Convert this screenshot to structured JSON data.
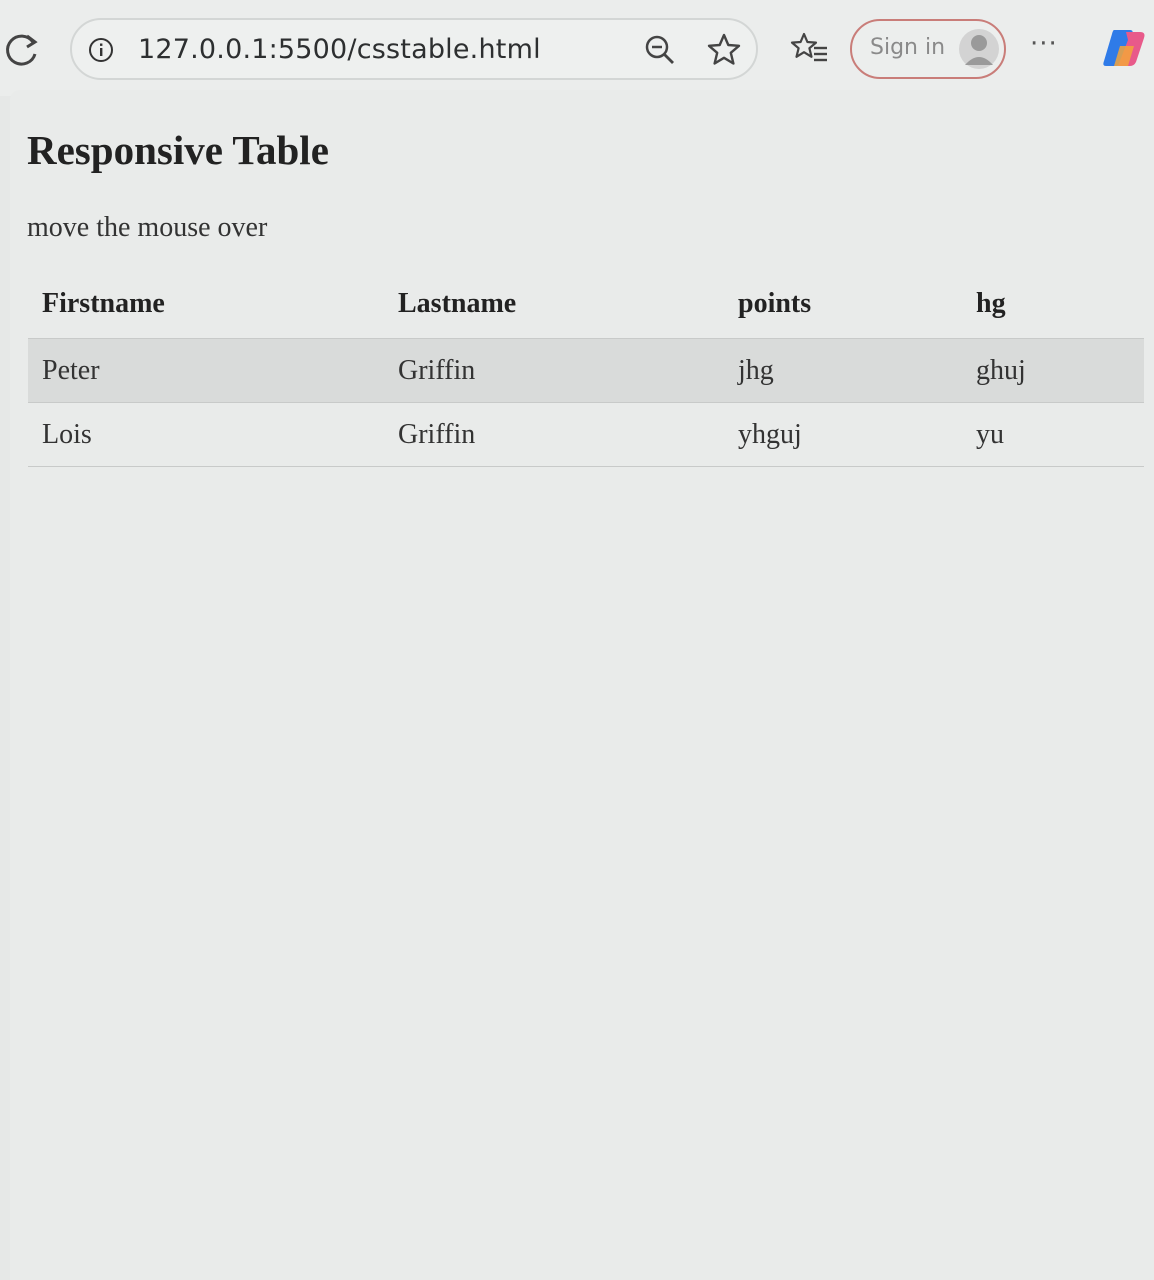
{
  "browser": {
    "url": "127.0.0.1:5500/csstable.html",
    "signin_label": "Sign in",
    "more_label": "···",
    "icons": [
      "reload-icon",
      "info-icon",
      "zoom-out-icon",
      "star-icon",
      "favorites-icon",
      "avatar",
      "more-icon",
      "copilot-icon"
    ]
  },
  "page": {
    "title": "Responsive Table",
    "subtitle": "move the mouse over"
  },
  "table": {
    "headers": [
      "Firstname",
      "Lastname",
      "points",
      "hg"
    ],
    "rows": [
      [
        "Peter",
        "Griffin",
        "jhg",
        "ghuj"
      ],
      [
        "Lois",
        "Griffin",
        "yhguj",
        "yu"
      ]
    ]
  },
  "colors": {
    "signin_border": "#c97d79",
    "hover_row": "#d9dbda"
  }
}
